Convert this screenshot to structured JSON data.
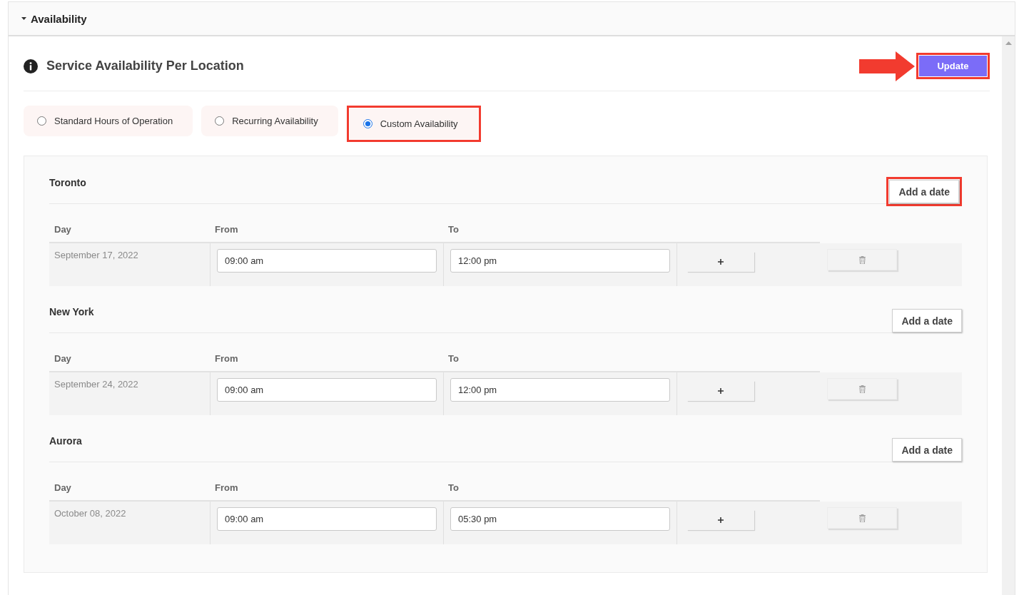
{
  "section": {
    "title": "Availability",
    "expanded": true
  },
  "panel": {
    "title": "Service Availability Per Location"
  },
  "update_button": {
    "label": "Update",
    "highlighted": true,
    "pointer_arrow": true
  },
  "availability_options": [
    {
      "label": "Standard Hours of Operation",
      "selected": false,
      "highlighted": false
    },
    {
      "label": "Recurring Availability",
      "selected": false,
      "highlighted": false
    },
    {
      "label": "Custom Availability",
      "selected": true,
      "highlighted": true
    }
  ],
  "locations": [
    {
      "name": "Toronto",
      "add_button": {
        "label": "Add a date",
        "highlighted": true
      },
      "columns": [
        "Day",
        "From",
        "To"
      ],
      "rows": [
        {
          "day": "September 17, 2022",
          "from": "09:00 am",
          "to": "12:00 pm"
        }
      ]
    },
    {
      "name": "New York",
      "add_button": {
        "label": "Add a date",
        "highlighted": false
      },
      "columns": [
        "Day",
        "From",
        "To"
      ],
      "rows": [
        {
          "day": "September 24, 2022",
          "from": "09:00 am",
          "to": "12:00 pm"
        }
      ]
    },
    {
      "name": "Aurora",
      "add_button": {
        "label": "Add a date",
        "highlighted": false
      },
      "columns": [
        "Day",
        "From",
        "To"
      ],
      "rows": [
        {
          "day": "October 08, 2022",
          "from": "09:00 am",
          "to": "05:30 pm"
        }
      ]
    }
  ]
}
